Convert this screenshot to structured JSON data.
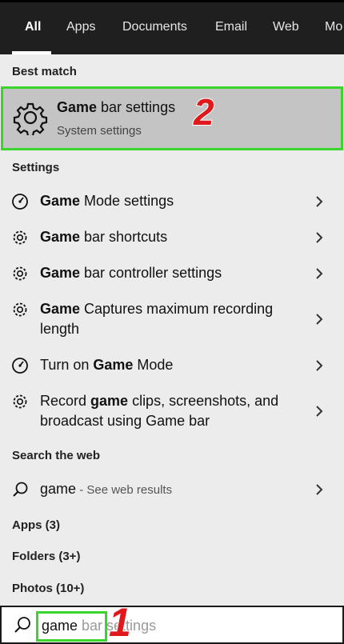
{
  "tabs": [
    {
      "label": "All",
      "active": true
    },
    {
      "label": "Apps"
    },
    {
      "label": "Documents"
    },
    {
      "label": "Email"
    },
    {
      "label": "Web"
    },
    {
      "label": "Mo"
    }
  ],
  "best_match": {
    "heading": "Best match",
    "title_bold": "Game",
    "title_rest": " bar settings",
    "subtitle": "System settings",
    "annotation": "2"
  },
  "settings": {
    "heading": "Settings",
    "items": [
      {
        "icon": "speedometer-icon",
        "bold": "Game",
        "rest": " Mode settings"
      },
      {
        "icon": "gear-icon",
        "bold": "Game",
        "rest": " bar shortcuts"
      },
      {
        "icon": "gear-icon",
        "bold": "Game",
        "rest": " bar controller settings"
      },
      {
        "icon": "gear-icon",
        "bold": "Game",
        "rest": " Captures maximum recording length"
      },
      {
        "icon": "speedometer-icon",
        "pre": "Turn on ",
        "bold": "Game",
        "rest": " Mode"
      },
      {
        "icon": "gear-icon",
        "pre": "Record ",
        "bold": "game",
        "rest": " clips, screenshots, and broadcast using Game bar"
      }
    ]
  },
  "web": {
    "heading": "Search the web",
    "query": "game",
    "suffix": " - See web results"
  },
  "collapsed_sections": [
    {
      "label": "Apps (3)"
    },
    {
      "label": "Folders (3+)"
    },
    {
      "label": "Photos (10+)"
    }
  ],
  "search": {
    "typed": "game",
    "ghost": " bar settings",
    "annotation": "1"
  },
  "colors": {
    "highlight_border": "#3ad42a",
    "annotation_red": "#e0191c",
    "topbar": "#1f1f1f"
  }
}
